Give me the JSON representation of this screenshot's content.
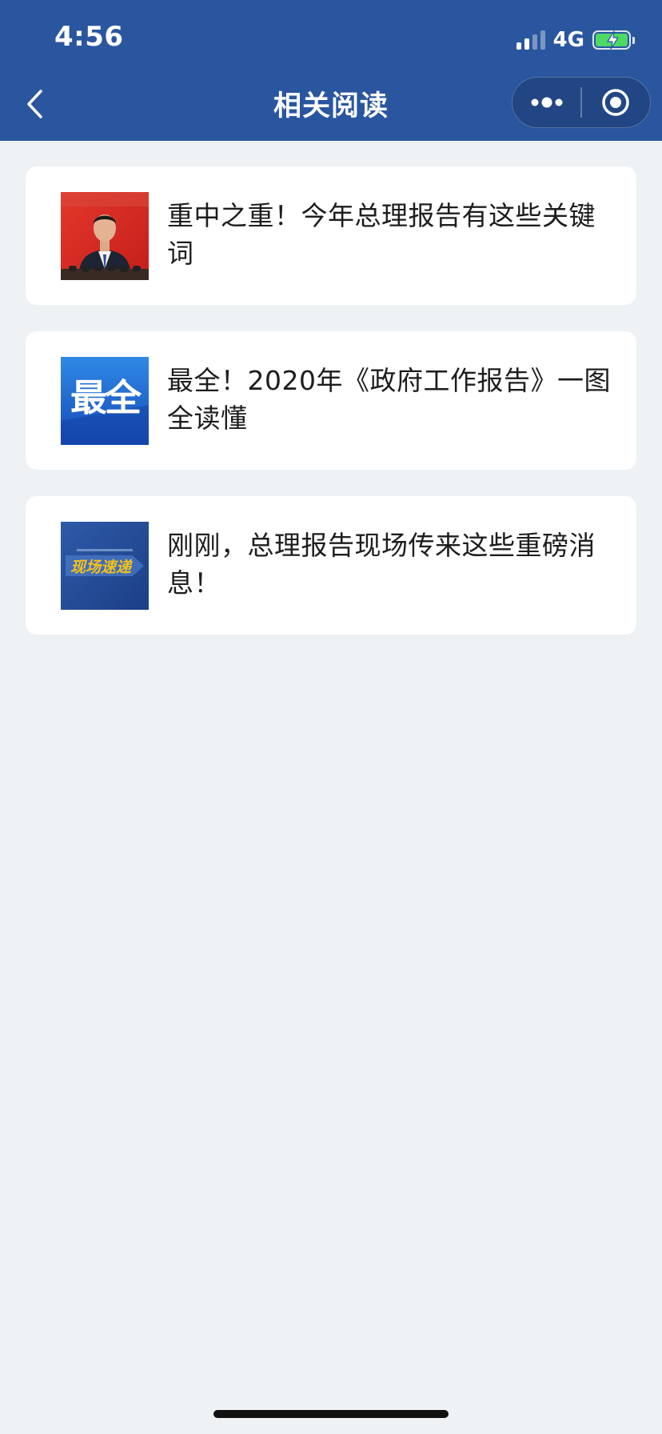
{
  "status_bar": {
    "time": "4:56",
    "network": "4G",
    "signal_bars": 2,
    "signal_bars_total": 4,
    "battery_level": 1.0,
    "charging": true
  },
  "nav": {
    "title": "相关阅读",
    "back_icon": "chevron-left-icon",
    "more_icon": "more-dots-icon",
    "close_icon": "target-close-icon"
  },
  "articles": [
    {
      "title": "重中之重！今年总理报告有这些关键词",
      "thumbnail": "speaker-photo"
    },
    {
      "title": "最全！2020年《政府工作报告》一图全读懂",
      "thumbnail": "zuiquan-banner",
      "thumbnail_text": "最全"
    },
    {
      "title": "刚刚，总理报告现场传来这些重磅消息！",
      "thumbnail": "xianchang-sudi-banner",
      "thumbnail_text": "现场速递"
    }
  ],
  "colors": {
    "nav_bg": "#2a56a0",
    "page_bg": "#eff2f5",
    "card_bg": "#ffffff",
    "title_text": "#1d1d1f",
    "battery_fill": "#4cd964"
  }
}
